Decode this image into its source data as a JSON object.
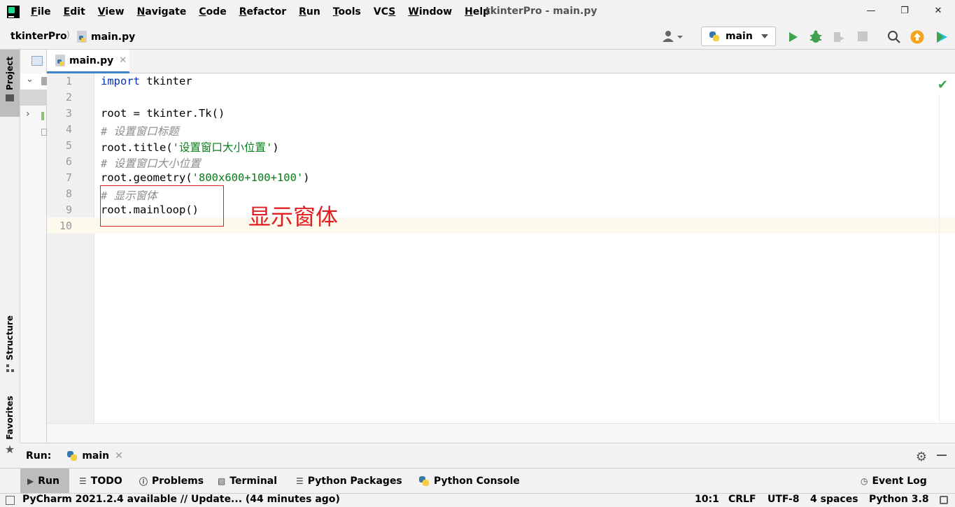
{
  "menubar": {
    "items": [
      {
        "prefix": "",
        "mnemonic": "F",
        "rest": "ile"
      },
      {
        "prefix": "",
        "mnemonic": "E",
        "rest": "dit"
      },
      {
        "prefix": "",
        "mnemonic": "V",
        "rest": "iew"
      },
      {
        "prefix": "",
        "mnemonic": "N",
        "rest": "avigate"
      },
      {
        "prefix": "",
        "mnemonic": "C",
        "rest": "ode"
      },
      {
        "prefix": "",
        "mnemonic": "R",
        "rest": "efactor"
      },
      {
        "prefix": "",
        "mnemonic": "R",
        "rest": "un"
      },
      {
        "prefix": "",
        "mnemonic": "T",
        "rest": "ools"
      },
      {
        "prefix": "VC",
        "mnemonic": "S",
        "rest": ""
      },
      {
        "prefix": "",
        "mnemonic": "W",
        "rest": "indow"
      },
      {
        "prefix": "",
        "mnemonic": "H",
        "rest": "elp"
      }
    ],
    "window_title": "tkinterPro - main.py"
  },
  "navbar": {
    "project": "tkinterPro",
    "file": "main.py",
    "run_config": "main"
  },
  "left_strip": {
    "project_label": "Project",
    "structure_label": "Structure",
    "favorites_label": "Favorites"
  },
  "editor": {
    "tab_label": "main.py",
    "line_numbers": [
      "1",
      "2",
      "3",
      "4",
      "5",
      "6",
      "7",
      "8",
      "9",
      "10"
    ],
    "lines": [
      {
        "kw": "import",
        "rest": " tkinter"
      },
      {
        "text": ""
      },
      {
        "text": "root = tkinter.Tk()"
      },
      {
        "comment": "# 设置窗口标题"
      },
      {
        "pre": "root.title(",
        "str": "'设置窗口大小位置'",
        "post": ")"
      },
      {
        "comment": "# 设置窗口大小位置"
      },
      {
        "pre": "root.geometry(",
        "str": "'800x600+100+100'",
        "post": ")"
      },
      {
        "comment": "# 显示窗体"
      },
      {
        "text": "root.mainloop()"
      },
      {
        "text": ""
      }
    ],
    "annotation": "显示窗体"
  },
  "run_panel": {
    "title": "Run:",
    "tab_label": "main"
  },
  "bottom_tools": {
    "run": "Run",
    "todo": "TODO",
    "problems": "Problems",
    "terminal": "Terminal",
    "python_packages": "Python Packages",
    "python_console": "Python Console",
    "event_log": "Event Log"
  },
  "statusbar": {
    "message": "PyCharm 2021.2.4 available // Update... (44 minutes ago)",
    "position": "10:1",
    "line_separator": "CRLF",
    "encoding": "UTF-8",
    "indent": "4 spaces",
    "interpreter": "Python 3.8"
  },
  "colors": {
    "keyword": "#0033b3",
    "string": "#067d17",
    "comment": "#8c8c8c",
    "annotation_red": "#e02020",
    "run_green": "#3fa34d",
    "tab_underline": "#4083c9"
  }
}
